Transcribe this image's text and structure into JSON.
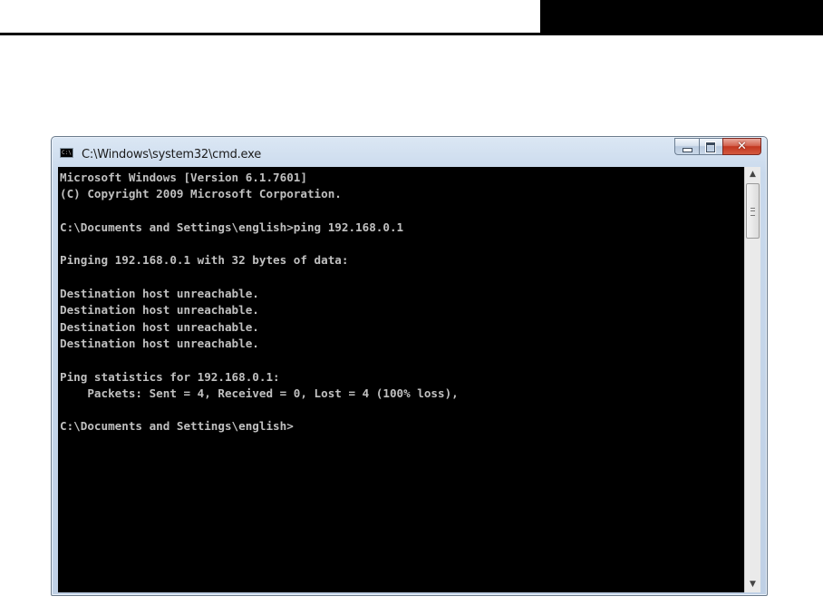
{
  "window": {
    "title": "C:\\Windows\\system32\\cmd.exe",
    "icon": "console-icon",
    "icon_text": "C:\\"
  },
  "caption_buttons": {
    "minimize_icon": "minimize-icon",
    "maximize_icon": "maximize-icon",
    "close_icon": "close-icon",
    "close_glyph": "✕"
  },
  "console": {
    "lines": [
      "Microsoft Windows [Version 6.1.7601]",
      "(C) Copyright 2009 Microsoft Corporation.",
      "",
      "C:\\Documents and Settings\\english>ping 192.168.0.1",
      "",
      "Pinging 192.168.0.1 with 32 bytes of data:",
      "",
      "Destination host unreachable.",
      "Destination host unreachable.",
      "Destination host unreachable.",
      "Destination host unreachable.",
      "",
      "Ping statistics for 192.168.0.1:",
      "    Packets: Sent = 4, Received = 0, Lost = 4 (100% loss),",
      "",
      "C:\\Documents and Settings\\english>"
    ]
  },
  "scrollbar": {
    "up_glyph": "▲",
    "down_glyph": "▼"
  },
  "colors": {
    "console_background": "#000000",
    "console_text": "#c0c0c0",
    "close_button": "#c2361f"
  }
}
